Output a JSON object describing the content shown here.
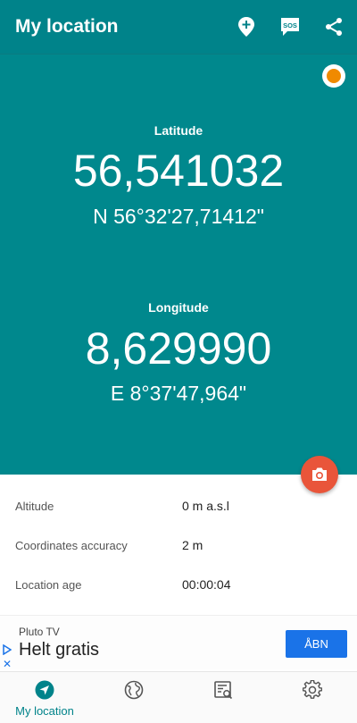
{
  "topbar": {
    "title": "My location",
    "icons": [
      "add-location-icon",
      "sos-icon",
      "share-icon"
    ],
    "sos_text": "SOS"
  },
  "colors": {
    "primary": "#00838a",
    "hero": "#00888d",
    "status": "#f08a00",
    "fab": "#e9553a",
    "cta": "#1a73e8"
  },
  "latitude": {
    "label": "Latitude",
    "decimal": "56,541032",
    "dms": "N 56°32'27,71412\""
  },
  "longitude": {
    "label": "Longitude",
    "decimal": "8,629990",
    "dms": "E 8°37'47,964\""
  },
  "details": [
    {
      "label": "Altitude",
      "value": "0 m a.s.l"
    },
    {
      "label": "Coordinates accuracy",
      "value": "2 m"
    },
    {
      "label": "Location age",
      "value": "00:00:04"
    }
  ],
  "ad": {
    "sponsor": "Pluto TV",
    "headline": "Helt gratis",
    "cta": "ÅBN"
  },
  "bottom_nav": [
    {
      "icon": "navigation-icon",
      "label": "My location",
      "active": true
    },
    {
      "icon": "globe-icon",
      "label": ""
    },
    {
      "icon": "list-search-icon",
      "label": ""
    },
    {
      "icon": "gear-icon",
      "label": ""
    }
  ]
}
